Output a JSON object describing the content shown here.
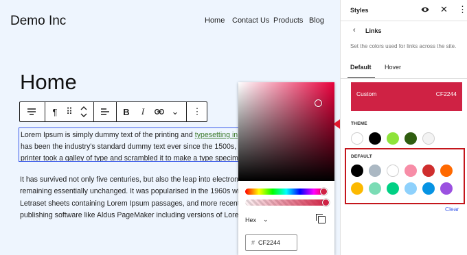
{
  "site": {
    "title": "Demo Inc",
    "nav": [
      "Home",
      "Contact Us",
      "Products",
      "Blog"
    ]
  },
  "content": {
    "heading": "Home",
    "paragraph1": {
      "line1_before": "Lorem Ipsum is simply dummy text of the printing and ",
      "line1_link": "typesetting in",
      "line2": "has been the industry's standard dummy text ever since the 1500s, w",
      "line3": "printer took a galley of type and scrambled it to make a type specime"
    },
    "paragraph2": [
      "It has survived not only five centuries, but also the leap into electroni",
      "remaining essentially unchanged. It was popularised in the 1960s with",
      "Letraset sheets containing Lorem Ipsum passages, and more recently",
      "publishing software like Aldus PageMaker including versions of Loren"
    ]
  },
  "toolbar": {
    "paragraph_icon": "¶",
    "drag_icon": "⠿",
    "move_icon": "⌃⌄",
    "align_icon": "align-icon",
    "bold": "B",
    "italic": "I",
    "link_icon": "link-icon",
    "more_icon": "⌄",
    "options_icon": "⋮"
  },
  "picker": {
    "format": "Hex",
    "hash": "#",
    "value": "CF2244",
    "base_hue_color": "#e8003c"
  },
  "sidebar": {
    "title": "Styles",
    "subtitle": "Links",
    "description": "Set the colors used for links across the site.",
    "tabs": [
      "Default",
      "Hover"
    ],
    "custom": {
      "name": "Custom",
      "value": "CF2244",
      "color": "#cf2244"
    },
    "theme_label": "THEME",
    "theme_colors": [
      "#ffffff",
      "#000000",
      "#8ee33a",
      "#2f5d10",
      "#f3f3f3"
    ],
    "default_label": "DEFAULT",
    "default_colors": [
      "#000000",
      "#abb8c3",
      "#ffffff",
      "#f78da7",
      "#cf2e2e",
      "#ff6900",
      "#fcb900",
      "#7bdcb5",
      "#00d084",
      "#8ed1fc",
      "#0693e3",
      "#9b51e0"
    ],
    "clear": "Clear"
  },
  "annotation": {
    "highlight_color": "#c4161c"
  }
}
